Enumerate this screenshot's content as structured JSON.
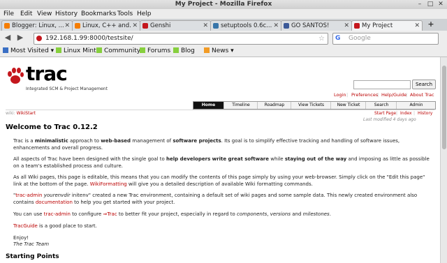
{
  "window": {
    "title": "My Project - Mozilla Firefox",
    "min_label": "–",
    "max_label": "□",
    "close_label": "✕"
  },
  "menu": [
    "File",
    "Edit",
    "View",
    "History",
    "Bookmarks",
    "Tools",
    "Help"
  ],
  "tabs": [
    {
      "label": "Blogger: Linux, ...",
      "fav_color": "#f57d00"
    },
    {
      "label": "Linux, C++ and...",
      "fav_color": "#f57d00"
    },
    {
      "label": "Genshi",
      "fav_color": "#c4171d"
    },
    {
      "label": "setuptools 0.6c...",
      "fav_color": "#3775a9"
    },
    {
      "label": "GO SANTOS!",
      "fav_color": "#3b5998"
    },
    {
      "label": "My Project",
      "fav_color": "#c4171d"
    }
  ],
  "tab_close_label": "✕",
  "new_tab_label": "+",
  "navbar": {
    "back_label": "◀",
    "forward_label": "▶",
    "url": "192.168.1.99:8000/testsite/",
    "star_label": "☆",
    "search_engine_label": "G",
    "search_placeholder": "Google"
  },
  "bookmarks": [
    {
      "label": "Most Visited ▾",
      "icon_color": "#3a6fc4"
    },
    {
      "label": "Linux Mint",
      "icon_color": "#87cf3e"
    },
    {
      "label": "Community",
      "icon_color": "#87cf3e"
    },
    {
      "label": "Forums",
      "icon_color": "#87cf3e"
    },
    {
      "label": "Blog",
      "icon_color": "#87cf3e"
    },
    {
      "label": "News ▾",
      "icon_color": "#f29b26"
    }
  ],
  "trac": {
    "logo_text": "trac",
    "logo_subtitle": "Integrated SCM & Project Management",
    "search_button": "Search",
    "metanav": [
      "Login",
      "Preferences",
      "Help/Guide",
      "About Trac"
    ],
    "mainnav": [
      "Home",
      "Timeline",
      "Roadmap",
      "View Tickets",
      "New Ticket",
      "Search",
      "Admin"
    ],
    "breadcrumb_prefix": "wiki:",
    "breadcrumb_page": "WikiStart",
    "ctxnav": [
      "Start Page",
      "Index",
      "History"
    ],
    "last_modified": "Last modified 4 days ago",
    "heading": "Welcome to Trac 0.12.2",
    "p1": {
      "a": "Trac is a ",
      "b": "minimalistic",
      "c": " approach to ",
      "d": "web-based",
      "e": " management of ",
      "f": "software projects",
      "g": ". Its goal is to simplify effective tracking and handling of software issues, enhancements and overall progress."
    },
    "p2": {
      "a": "All aspects of Trac have been designed with the single goal to ",
      "b": "help developers write great software",
      "c": " while ",
      "d": "staying out of the way",
      "e": " and imposing as little as possible on a team's established process and culture."
    },
    "p3": {
      "a": "As all Wiki pages, this page is editable, this means that you can modify the contents of this page simply by using your web-browser. Simply click on the \"Edit this page\" link at the bottom of the page. ",
      "link": "WikiFormatting",
      "b": " will give you a detailed description of available Wiki formatting commands."
    },
    "p4": {
      "a": "\"",
      "cmd": "trac-admin",
      "b": " ",
      "arg": "yourenvdir",
      "c": " initenv\" created a new Trac environment, containing a default set of wiki pages and some sample data. This newly created environment also contains ",
      "link": "documentation",
      "d": " to help you get started with your project."
    },
    "p5": {
      "a": "You can use ",
      "link1": "trac-admin",
      "b": " to configure ",
      "link2": "⇒Trac",
      "c": " to better fit your project, especially in regard to ",
      "d": "components",
      "e": ", ",
      "f": "versions",
      "g": " and ",
      "h": "milestones",
      "i": "."
    },
    "p6": {
      "link": "TracGuide",
      "a": " is a good place to start."
    },
    "enjoy": "Enjoy!",
    "signature": "The Trac Team",
    "starting_points": "Starting Points"
  }
}
